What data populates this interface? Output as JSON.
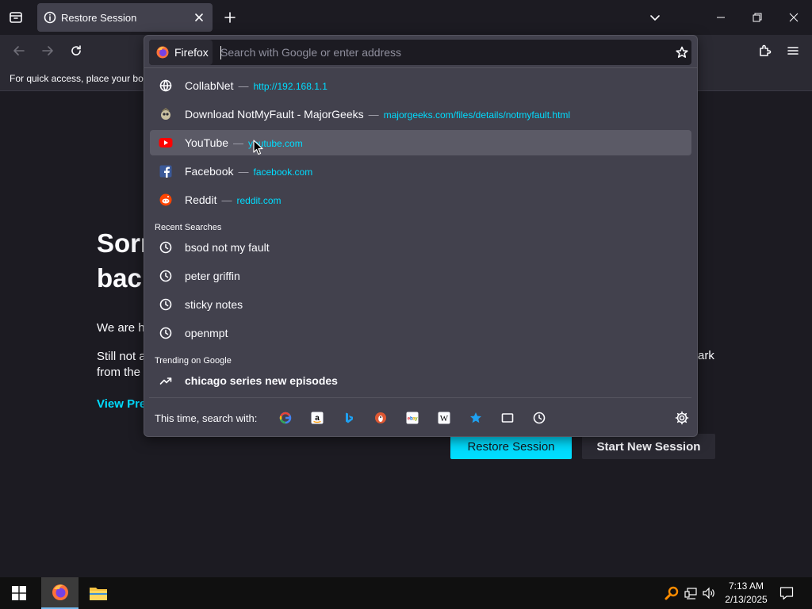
{
  "colors": {
    "accent": "#00ddff",
    "panel_bg": "#42414d",
    "selected_row": "#5b5a66",
    "page_bg": "#1c1b22"
  },
  "tab": {
    "title": "Restore Session",
    "icon": "info-icon"
  },
  "bookmarks_bar": {
    "hint": "For quick access, place your boo"
  },
  "urlbar": {
    "engine_label": "Firefox",
    "placeholder": "Search with Google or enter address",
    "value": ""
  },
  "suggestions": [
    {
      "title": "CollabNet",
      "url": "http://192.168.1.1",
      "icon": "globe-icon"
    },
    {
      "title": "Download NotMyFault - MajorGeeks",
      "url": "majorgeeks.com/files/details/notmyfault.html",
      "icon": "majorgeeks-icon"
    },
    {
      "title": "YouTube",
      "url": "youtube.com",
      "icon": "youtube-icon",
      "selected": true
    },
    {
      "title": "Facebook",
      "url": "facebook.com",
      "icon": "facebook-icon"
    },
    {
      "title": "Reddit",
      "url": "reddit.com",
      "icon": "reddit-icon"
    }
  ],
  "separator": "—",
  "recent_searches": {
    "label": "Recent Searches",
    "items": [
      "bsod not my fault",
      "peter griffin",
      "sticky notes",
      "openmpt"
    ]
  },
  "trending": {
    "label": "Trending on Google",
    "items": [
      "chicago series new episodes"
    ]
  },
  "one_offs": {
    "label": "This time, search with:",
    "engines": [
      "google-icon",
      "amazon-icon",
      "bing-icon",
      "duckduckgo-icon",
      "ebay-icon",
      "wikipedia-icon",
      "bookmarks-icon",
      "tabs-icon",
      "history-icon"
    ]
  },
  "page": {
    "title": "Sorr\nbacl",
    "text1": "We are h",
    "text2": "Still not a\nfrom the",
    "text2_end": "ark",
    "link": "View Pre",
    "restore_button": "Restore Session",
    "new_session_button": "Start New Session"
  },
  "taskbar": {
    "time": "7:13 AM",
    "date": "2/13/2025"
  }
}
